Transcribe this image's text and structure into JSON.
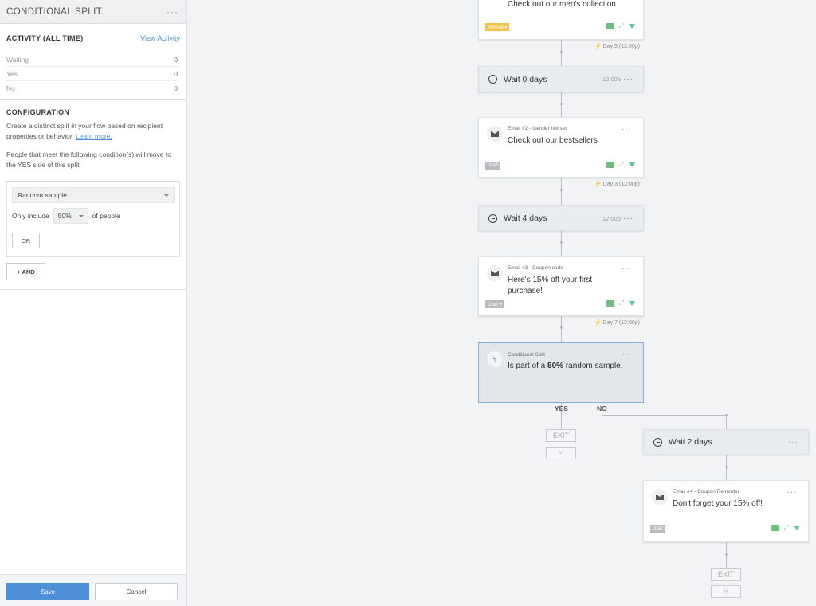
{
  "panel": {
    "title": "CONDITIONAL SPLIT",
    "menu_icon": "more-dots-icon",
    "activity": {
      "title": "ACTIVITY (ALL TIME)",
      "view_link": "View Activity",
      "rows": [
        {
          "label": "Waiting",
          "value": "0"
        },
        {
          "label": "Yes",
          "value": "0"
        },
        {
          "label": "No",
          "value": "0"
        }
      ]
    },
    "config": {
      "title": "CONFIGURATION",
      "desc_1": "Create a distinct split in your flow based on recipient properties or behavior.",
      "learn_more": "Learn more.",
      "desc_2": "People that meet the following condition(s) will move to the YES side of this split:",
      "condition_type": "Random sample",
      "only_include": "Only include",
      "percent": "50%",
      "of_people": "of people",
      "or_button": "OR",
      "and_button": "+ AND"
    },
    "footer": {
      "save": "Save",
      "cancel": "Cancel"
    }
  },
  "flow": {
    "email1": {
      "main": "Check out our men's collection",
      "tag": "Manual ▾",
      "day_label": "⚡ Day 3 (12:00p)"
    },
    "wait1": {
      "label": "Wait 0 days",
      "time": "12:00p"
    },
    "email2": {
      "sub": "Email #2 - Gender not set",
      "main": "Check out our bestsellers",
      "tag": "Draft",
      "day_label": "⚡ Day 3 (12:00p)"
    },
    "wait2": {
      "label": "Wait 4 days",
      "time": "12:00p"
    },
    "email3": {
      "sub": "Email #3 - Coupon code",
      "main": "Here's 15% off your first purchase!",
      "tag": "Draft ▾",
      "day_label": "⚡ Day 7 (12:00p)"
    },
    "split": {
      "sub": "Conditional Split",
      "main_pre": "Is part of a ",
      "main_bold": "50%",
      "main_post": " random sample."
    },
    "yes": "YES",
    "no": "NO",
    "exit": "EXIT",
    "wait3": {
      "label": "Wait 2 days"
    },
    "email4": {
      "sub": "Email #4 - Coupon Reminder",
      "main": "Don't forget your 15% off!",
      "tag": "Draft"
    },
    "exit2": "EXIT"
  },
  "colors": {
    "accent": "#4d90d8",
    "selection_border": "#7fb2e0",
    "manual_tag": "#f2c344",
    "draft_tag": "#b9bdc1",
    "action_green": "#6cc07c"
  }
}
